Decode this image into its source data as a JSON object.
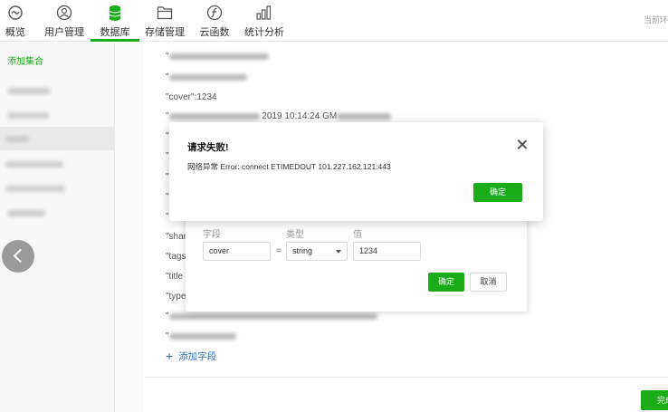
{
  "toolbar": {
    "tabs": [
      {
        "label": "概览",
        "icon": "overview-icon"
      },
      {
        "label": "用户管理",
        "icon": "user-icon"
      },
      {
        "label": "数据库",
        "icon": "database-icon"
      },
      {
        "label": "存储管理",
        "icon": "folder-icon"
      },
      {
        "label": "云函数",
        "icon": "function-icon"
      },
      {
        "label": "统计分析",
        "icon": "chart-icon"
      }
    ],
    "active_tab": "数据库",
    "right_text": "当前环"
  },
  "sidebar": {
    "add_collection": "添加集合"
  },
  "record": {
    "cover_key": "\"cover\"",
    "cover_value": "1234",
    "date_fragment": "2019 10:14:24 GM",
    "fields": [
      "\"shar",
      "\"tags",
      "\"title",
      "\"type"
    ],
    "add_field": "添加字段"
  },
  "edit_panel": {
    "col_field": "字段",
    "col_type": "类型",
    "col_value": "值",
    "field_value": "cover",
    "equals": "=",
    "type_value": "string",
    "value_value": "1234",
    "ok": "确定",
    "cancel": "取消"
  },
  "error_modal": {
    "title": "请求失败!",
    "message": "网络异常 Error: connect ETIMEDOUT 101.227.162.121:443",
    "ok": "确定"
  },
  "footer": {
    "done": "完成"
  },
  "colors": {
    "accent": "#1aad19",
    "link": "#2e6dbd"
  }
}
